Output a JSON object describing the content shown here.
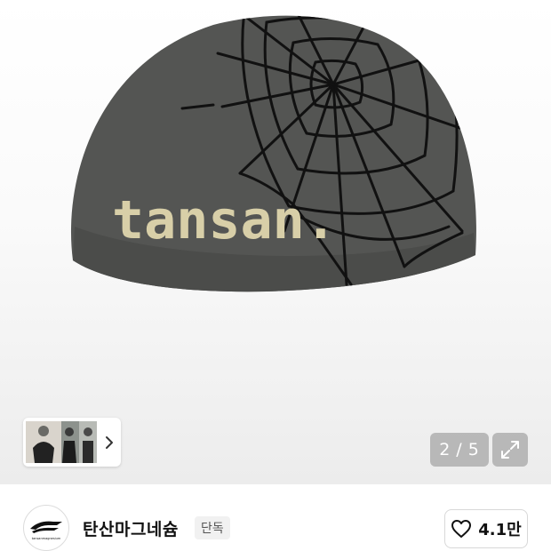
{
  "product_image": {
    "knit_text": "tansan.",
    "colors": {
      "hat": "#545553",
      "web": "#111111",
      "lettering": "#d8cfa8"
    }
  },
  "gallery": {
    "current": "2",
    "separator": "/",
    "total": "5",
    "thumb_next_icon": "chevron-right-icon",
    "expand_icon": "expand-arrows-icon"
  },
  "shop": {
    "logo_caption": "tansanmagnesium",
    "name": "탄산마그네슘",
    "badge": "단독"
  },
  "like": {
    "icon": "heart-outline-icon",
    "count": "4.1만"
  }
}
